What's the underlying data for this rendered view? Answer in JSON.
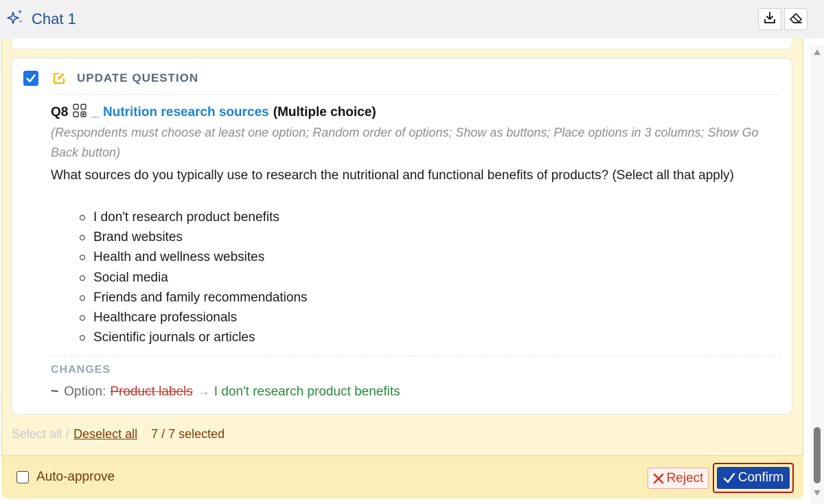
{
  "header": {
    "title": "Chat 1",
    "icons": [
      "sparkle-icon",
      "download-icon",
      "eraser-icon"
    ]
  },
  "card": {
    "checked": true,
    "action_title": "UPDATE QUESTION",
    "question": {
      "number": "Q8",
      "underscore": "_",
      "name": "Nutrition research sources",
      "type": "(Multiple choice)",
      "settings": "(Respondents must choose at least one option; Random order of options; Show as buttons; Place options in 3 columns; Show Go Back button)",
      "text": "What sources do you typically use to research the nutritional and functional benefits of products? (Select all that apply)",
      "options": [
        "I don't research product benefits",
        "Brand websites",
        "Health and wellness websites",
        "Social media",
        "Friends and family recommendations",
        "Healthcare professionals",
        "Scientific journals or articles"
      ]
    },
    "changes": {
      "heading": "CHANGES",
      "tilde": "~",
      "label": "Option:",
      "old_value": "Product labels",
      "arrow": "→",
      "new_value": "I don't research product benefits"
    }
  },
  "selection": {
    "select_all": "Select all",
    "separator": "/",
    "deselect_all": "Deselect all",
    "count": "7 / 7 selected"
  },
  "footer": {
    "auto_approve": "Auto-approve",
    "reject": "Reject",
    "confirm": "Confirm"
  },
  "colors": {
    "accent_blue": "#1a73e8",
    "link_blue": "#1a84d8",
    "confirm_blue": "#1746a8",
    "reject_red": "#d93025",
    "added_green": "#2b8a3e",
    "panel_yellow": "#fdf5d3"
  }
}
